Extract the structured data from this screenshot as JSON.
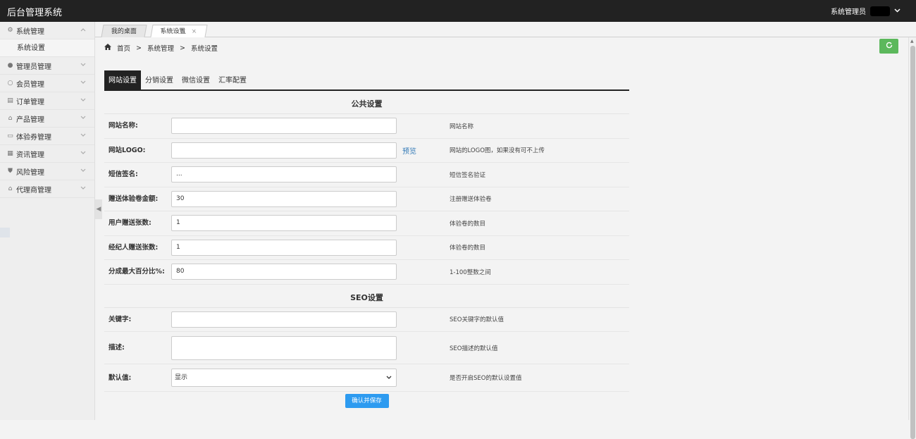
{
  "app": {
    "title": "后台管理系统",
    "user": "系统管理员"
  },
  "sidebar": {
    "items": [
      {
        "label": "系统管理",
        "icon": "gear-icon",
        "open": true,
        "sub": [
          "系统设置"
        ]
      },
      {
        "label": "管理员管理",
        "icon": "user-icon"
      },
      {
        "label": "会员管理",
        "icon": "member-icon"
      },
      {
        "label": "订单管理",
        "icon": "order-icon"
      },
      {
        "label": "产品管理",
        "icon": "product-icon"
      },
      {
        "label": "体验券管理",
        "icon": "coupon-icon"
      },
      {
        "label": "资讯管理",
        "icon": "news-icon"
      },
      {
        "label": "风险管理",
        "icon": "shield-icon"
      },
      {
        "label": "代理商管理",
        "icon": "agent-icon"
      }
    ]
  },
  "tabs": [
    {
      "label": "我的桌面"
    },
    {
      "label": "系统设置",
      "close": "×"
    }
  ],
  "breadcrumb": {
    "home": "首页",
    "sep": ">",
    "level1": "系统管理",
    "level2": "系统设置"
  },
  "settings_tabs": [
    "网站设置",
    "分销设置",
    "微信设置",
    "汇率配置"
  ],
  "sections": {
    "public": "公共设置",
    "seo": "SEO设置"
  },
  "fields": {
    "site_name": {
      "label": "网站名称:",
      "value": "",
      "hint": "网站名称"
    },
    "site_logo": {
      "label": "网站LOGO:",
      "value": "",
      "preview": "预览",
      "hint": "网站的LOGO图，如果没有可不上传"
    },
    "sms_sign": {
      "label": "短信签名:",
      "value": "...",
      "hint": "短信签名验证"
    },
    "gift_amount": {
      "label": "赠送体验卷金额:",
      "value": "30",
      "hint": "注册赠送体验卷"
    },
    "user_gift_count": {
      "label": "用户赠送张数:",
      "value": "1",
      "hint": "体验卷的数目"
    },
    "agent_gift_count": {
      "label": "经纪人赠送张数:",
      "value": "1",
      "hint": "体验卷的数目"
    },
    "max_percent": {
      "label": "分成最大百分比%:",
      "value": "80",
      "hint": "1-100整数之间"
    },
    "keywords": {
      "label": "关键字:",
      "value": "",
      "hint": "SEO关键字的默认值"
    },
    "description": {
      "label": "描述:",
      "value": "",
      "hint": "SEO描述的默认值"
    },
    "default": {
      "label": "默认值:",
      "value": "显示",
      "hint": "是否开启SEO的默认设置值"
    }
  },
  "save_label": "确认并保存"
}
